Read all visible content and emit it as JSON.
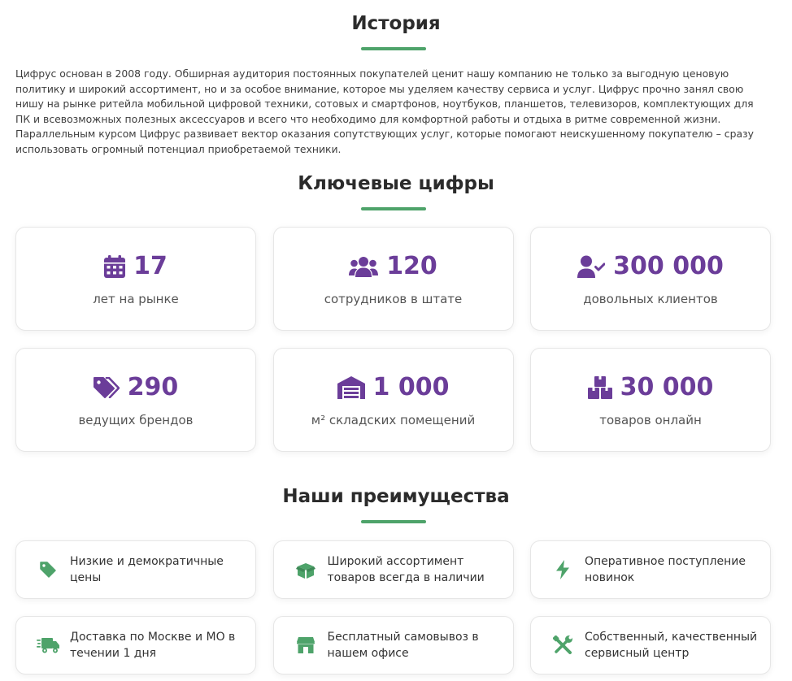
{
  "colors": {
    "accent_green": "#4ea36a",
    "accent_purple": "#6b3d99"
  },
  "history": {
    "title": "История",
    "text": "Цифрус основан в 2008 году. Обширная аудитория постоянных покупателей ценит нашу компанию не только за выгодную ценовую политику и широкий ассортимент, но и за особое внимание, которое мы уделяем качеству сервиса и услуг. Цифрус прочно занял свою нишу на рынке ритейла мобильной цифровой техники, сотовых и смартфонов, ноутбуков, планшетов, телевизоров, комплектующих для ПК и всевозможных полезных аксессуаров и всего что необходимо для комфортной работы и отдыха в ритме современной жизни. Параллельным курсом Цифрус развивает вектор оказания сопутствующих услуг, которые помогают неискушенному покупателю – сразу использовать огромный потенциал приобретаемой техники."
  },
  "key_figures": {
    "title": "Ключевые цифры",
    "items": [
      {
        "icon": "calendar-icon",
        "value": "17",
        "label": "лет на рынке"
      },
      {
        "icon": "users-icon",
        "value": "120",
        "label": "сотрудников в штате"
      },
      {
        "icon": "user-check-icon",
        "value": "300 000",
        "label": "довольных клиентов"
      },
      {
        "icon": "tags-icon",
        "value": "290",
        "label": "ведущих брендов"
      },
      {
        "icon": "warehouse-icon",
        "value": "1 000",
        "label": "м² складских помещений"
      },
      {
        "icon": "boxes-icon",
        "value": "30 000",
        "label": "товаров онлайн"
      }
    ]
  },
  "advantages": {
    "title": "Наши преимущества",
    "items": [
      {
        "icon": "price-tag-icon",
        "text": "Низкие и демократичные цены"
      },
      {
        "icon": "open-box-icon",
        "text": "Широкий ассортимент товаров всегда в наличии"
      },
      {
        "icon": "lightning-icon",
        "text": "Оперативное поступление новинок"
      },
      {
        "icon": "delivery-truck-icon",
        "text": "Доставка по Москве и МО в течении 1 дня"
      },
      {
        "icon": "store-icon",
        "text": "Бесплатный самовывоз в нашем офисе"
      },
      {
        "icon": "tools-icon",
        "text": "Собственный, качественный сервисный центр"
      }
    ]
  }
}
